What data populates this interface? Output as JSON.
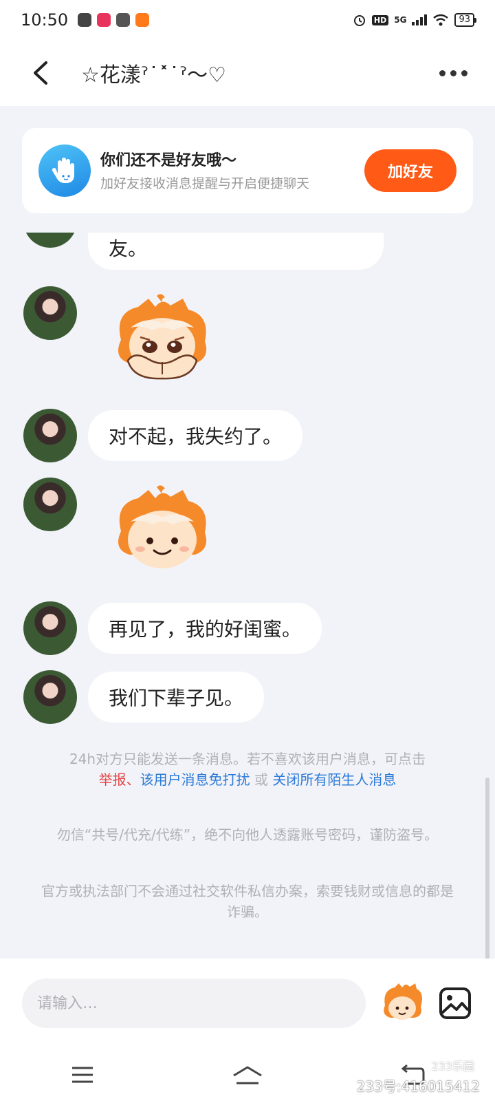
{
  "status_bar": {
    "time": "10:50",
    "hd": "HD",
    "network": "5G",
    "battery": "93"
  },
  "header": {
    "title": "☆花漾ˀ˙˟˙ˀ～♡"
  },
  "friend_banner": {
    "title": "你们还不是好友哦～",
    "subtitle": "加好友接收消息提醒与开启便捷聊天",
    "button": "加好友"
  },
  "messages": [
    {
      "type": "text",
      "text": "友。"
    },
    {
      "type": "sticker",
      "icon": "sad-mascot-sticker"
    },
    {
      "type": "text",
      "text": "对不起，我失约了。"
    },
    {
      "type": "sticker",
      "icon": "smiling-mascot-sticker"
    },
    {
      "type": "text",
      "text": "再见了，我的好闺蜜。"
    },
    {
      "type": "text",
      "text": "我们下辈子见。"
    }
  ],
  "notice": {
    "limit_text": "24h对方只能发送一条消息。若不喜欢该用户消息，可点击",
    "report": "举报",
    "sep1": "、",
    "dnd": "该用户消息免打扰",
    "or": " 或 ",
    "close_all": "关闭所有陌生人消息",
    "warning1": "勿信“共号/代充/代练”，绝不向他人透露账号密码，谨防盗号。",
    "warning2": "官方或执法部门不会通过社交软件私信办案，索要钱财或信息的都是诈骗。"
  },
  "input": {
    "placeholder": "请输入…"
  },
  "watermark": {
    "logo": "233乐园",
    "id": "233号:416015412"
  },
  "colors": {
    "accent": "#ff5b17",
    "link_red": "#e54545",
    "link_blue": "#2b7ad8",
    "background": "#f2f3f8"
  }
}
